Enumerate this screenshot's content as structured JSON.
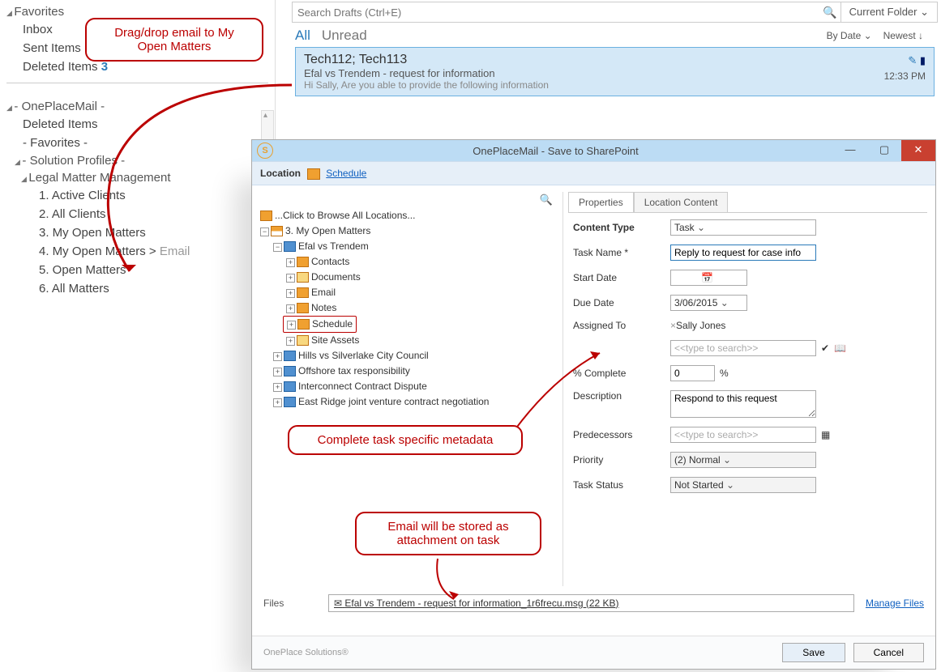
{
  "sidebar": {
    "favorites_label": "Favorites",
    "inbox": "Inbox",
    "sent": "Sent Items",
    "deleted": "Deleted Items",
    "deleted_count": "3",
    "opm": "- OnePlaceMail -",
    "opm_deleted": "Deleted Items",
    "opm_fav": "- Favorites -",
    "sp": "- Solution Profiles -",
    "lmm": "Legal Matter Management",
    "i1": "1. Active Clients",
    "i2": "2. All Clients",
    "i3": "3. My Open Matters",
    "i4_a": "4. My Open Matters > ",
    "i4_b": "Email",
    "i5": "5. Open Matters",
    "i6": "6. All Matters"
  },
  "mail": {
    "search_ph": "Search Drafts (Ctrl+E)",
    "scope": "Current Folder",
    "all": "All",
    "unread": "Unread",
    "sort1": "By Date",
    "sort2": "Newest",
    "to": "Tech112; Tech113",
    "subj": "Efal vs Trendem - request for information",
    "prev": "Hi Sally,  Are you able to provide the following information",
    "time": "12:33 PM"
  },
  "callouts": {
    "c1": "Drag/drop email to My Open Matters",
    "c2": "Complete task specific metadata",
    "c3": "Email will be stored as attachment on task"
  },
  "dialog": {
    "title": "OnePlaceMail - Save to SharePoint",
    "loc_label": "Location",
    "loc_link": "Schedule",
    "tree": {
      "root": "...Click to Browse All Locations...",
      "n1": "3. My Open Matters",
      "n2": "Efal vs Trendem",
      "contacts": "Contacts",
      "documents": "Documents",
      "email": "Email",
      "notes": "Notes",
      "schedule": "Schedule",
      "assets": "Site Assets",
      "m2": "Hills vs Silverlake City Council",
      "m3": "Offshore tax responsibility",
      "m4": "Interconnect Contract Dispute",
      "m5": "East Ridge joint venture contract negotiation"
    },
    "tabs": {
      "props": "Properties",
      "loc": "Location Content"
    },
    "form": {
      "ct_label": "Content Type",
      "ct_val": "Task",
      "tn_label": "Task Name *",
      "tn_val": "Reply to request for case info",
      "sd_label": "Start Date",
      "sd_val": "",
      "dd_label": "Due Date",
      "dd_val": "3/06/2015",
      "at_label": "Assigned To",
      "at_val": "Sally Jones",
      "at_ph": "<<type to search>>",
      "pc_label": "% Complete",
      "pc_val": "0",
      "pc_unit": "%",
      "de_label": "Description",
      "de_val": "Respond to this request",
      "pr_label": "Predecessors",
      "pr_ph": "<<type to search>>",
      "pi_label": "Priority",
      "pi_val": "(2) Normal",
      "ts_label": "Task Status",
      "ts_val": "Not Started"
    },
    "files_label": "Files",
    "file_name": "Efal vs Trendem - request for information_1r6frecu.msg (22 KB)",
    "manage": "Manage Files",
    "brand": "OnePlace Solutions®",
    "save": "Save",
    "cancel": "Cancel"
  }
}
